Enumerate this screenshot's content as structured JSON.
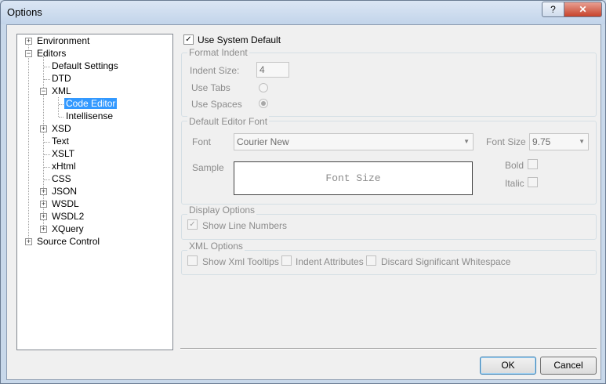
{
  "window": {
    "title": "Options",
    "help_label": "?",
    "close_label": "✕"
  },
  "tree": {
    "nodes": [
      {
        "label": "Environment",
        "expander": "+"
      },
      {
        "label": "Editors",
        "expander": "−"
      },
      {
        "label": "Default Settings"
      },
      {
        "label": "DTD"
      },
      {
        "label": "XML",
        "expander": "−"
      },
      {
        "label": "Code Editor",
        "selected": true
      },
      {
        "label": "Intellisense"
      },
      {
        "label": "XSD",
        "expander": "+"
      },
      {
        "label": "Text"
      },
      {
        "label": "XSLT"
      },
      {
        "label": "xHtml"
      },
      {
        "label": "CSS"
      },
      {
        "label": "JSON",
        "expander": "+"
      },
      {
        "label": "WSDL",
        "expander": "+"
      },
      {
        "label": "WSDL2",
        "expander": "+"
      },
      {
        "label": "XQuery",
        "expander": "+"
      },
      {
        "label": "Source Control",
        "expander": "+"
      }
    ]
  },
  "settings": {
    "use_system_default": {
      "label": "Use System Default",
      "checked": true,
      "mark": "✓"
    },
    "format_indent": {
      "title": "Format Indent",
      "indent_size_label": "Indent Size:",
      "indent_size_value": "4",
      "use_tabs_label": "Use Tabs",
      "use_spaces_label": "Use Spaces"
    },
    "default_editor_font": {
      "title": "Default Editor Font",
      "font_label": "Font",
      "font_value": "Courier New",
      "font_size_label": "Font Size",
      "font_size_value": "9.75",
      "sample_label": "Sample",
      "sample_text": "Font Size",
      "bold_label": "Bold",
      "italic_label": "Italic",
      "dropdown_arrow": "▼"
    },
    "display_options": {
      "title": "Display Options",
      "show_line_numbers_label": "Show Line Numbers",
      "show_line_numbers_mark": "✓"
    },
    "xml_options": {
      "title": "XML Options",
      "show_xml_tooltips_label": "Show Xml Tooltips",
      "indent_attributes_label": "Indent Attributes",
      "discard_whitespace_label": "Discard Significant Whitespace"
    }
  },
  "footer": {
    "ok_label": "OK",
    "cancel_label": "Cancel"
  }
}
